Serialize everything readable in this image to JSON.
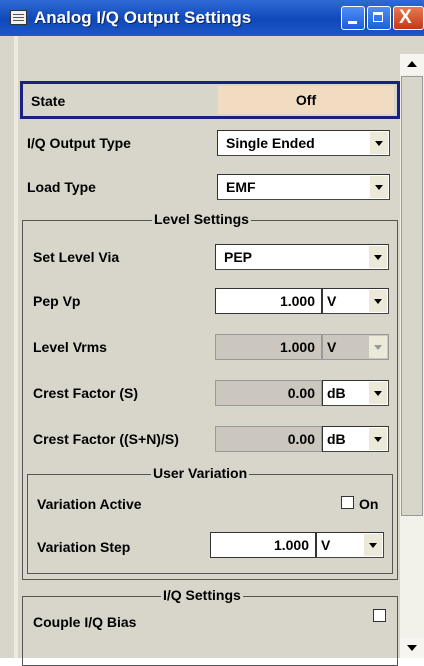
{
  "window": {
    "title": "Analog I/Q Output Settings",
    "close_glyph": "X"
  },
  "state": {
    "label": "State",
    "value": "Off"
  },
  "iq_output_type": {
    "label": "I/Q Output Type",
    "value": "Single Ended"
  },
  "load_type": {
    "label": "Load Type",
    "value": "EMF"
  },
  "level_settings": {
    "title": "Level Settings",
    "set_level_via": {
      "label": "Set Level Via",
      "value": "PEP"
    },
    "pep_vp": {
      "label": "Pep Vp",
      "value": "1.000",
      "unit": "V"
    },
    "level_vrms": {
      "label": "Level Vrms",
      "value": "1.000",
      "unit": "V"
    },
    "crest_factor_s": {
      "label": "Crest Factor (S)",
      "value": "0.00",
      "unit": "dB"
    },
    "crest_factor_sn": {
      "label": "Crest Factor ((S+N)/S)",
      "value": "0.00",
      "unit": "dB"
    },
    "user_variation": {
      "title": "User Variation",
      "variation_active": {
        "label": "Variation Active",
        "checkbox_label": "On",
        "checked": false
      },
      "variation_step": {
        "label": "Variation Step",
        "value": "1.000",
        "unit": "V"
      }
    }
  },
  "iq_settings": {
    "title": "I/Q Settings",
    "couple_iq_bias": {
      "label": "Couple I/Q Bias",
      "checked": false
    }
  },
  "colors": {
    "title_bar": "#0f48b9",
    "state_value_bg": "#f2dcc1",
    "state_border": "#1a2280",
    "panel_bg": "#d8d6cb"
  }
}
